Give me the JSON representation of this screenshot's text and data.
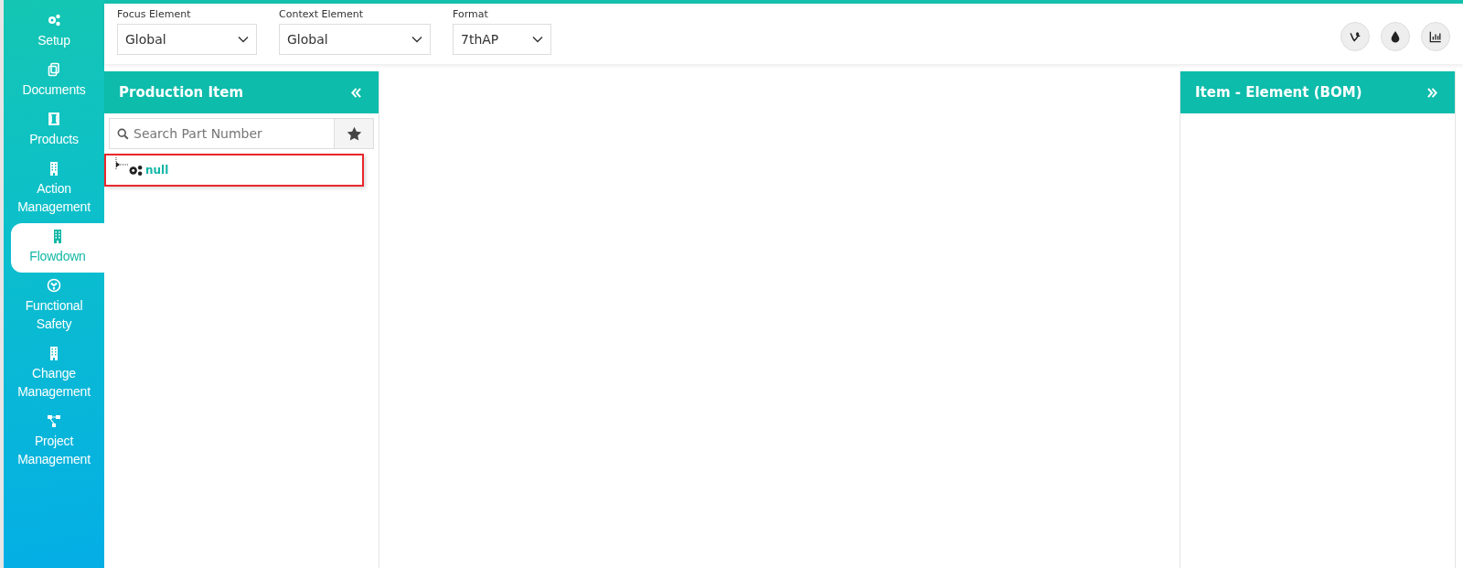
{
  "sidebar": {
    "items": [
      {
        "label": "Setup",
        "selected": false
      },
      {
        "label": "Documents",
        "selected": false
      },
      {
        "label": "Products",
        "selected": false
      },
      {
        "label": "Action Management",
        "selected": false
      },
      {
        "label": "Flowdown",
        "selected": true
      },
      {
        "label": "Functional Safety",
        "selected": false
      },
      {
        "label": "Change Management",
        "selected": false
      },
      {
        "label": "Project Management",
        "selected": false
      }
    ]
  },
  "toolbar": {
    "filters": [
      {
        "label": "Focus Element",
        "value": "Global"
      },
      {
        "label": "Context Element",
        "value": "Global"
      },
      {
        "label": "Format",
        "value": "7thAP"
      }
    ]
  },
  "left_panel": {
    "title": "Production Item",
    "search": {
      "placeholder": "Search Part Number"
    },
    "tree": [
      {
        "label": "null",
        "highlighted": true
      }
    ]
  },
  "right_panel": {
    "title": "Item - Element (BOM)"
  }
}
